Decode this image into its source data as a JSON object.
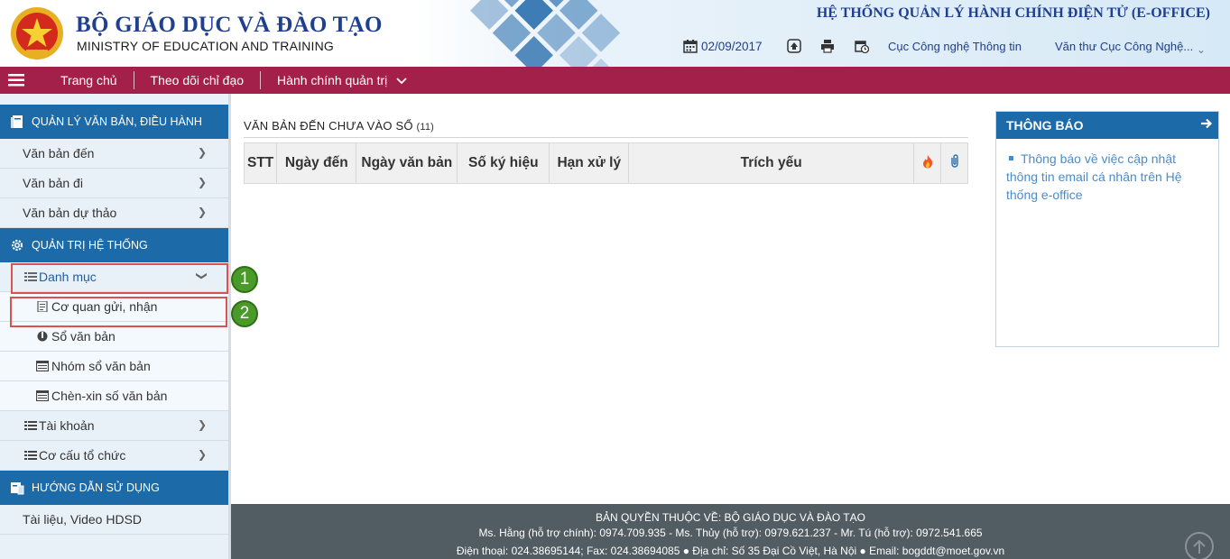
{
  "header": {
    "org_vn": "BỘ GIÁO DỤC VÀ ĐÀO TẠO",
    "org_en": "MINISTRY OF EDUCATION AND TRAINING",
    "system_title": "HỆ THỐNG QUẢN LÝ HÀNH CHÍNH ĐIỆN TỬ (E-OFFICE)",
    "date": "02/09/2017",
    "unit": "Cục Công nghệ Thông tin",
    "user": "Văn thư Cục Công Nghệ..."
  },
  "topnav": {
    "items": [
      {
        "label": "Trang chủ"
      },
      {
        "label": "Theo dõi chỉ đạo"
      },
      {
        "label": "Hành chính quản trị"
      }
    ]
  },
  "sidebar": {
    "section1": {
      "title": "QUẢN LÝ VĂN BẢN, ĐIỀU HÀNH",
      "items": [
        {
          "label": "Văn bản đến"
        },
        {
          "label": "Văn bản đi"
        },
        {
          "label": "Văn bản dự thảo"
        }
      ]
    },
    "section2": {
      "title": "QUẢN TRỊ HỆ THỐNG",
      "danhmuc": "Danh mục",
      "subitems": [
        {
          "label": "Cơ quan gửi, nhận"
        },
        {
          "label": "Sổ văn bản"
        },
        {
          "label": "Nhóm sổ văn bản"
        },
        {
          "label": "Chèn-xin số văn bản"
        }
      ],
      "taikhoan": "Tài khoản",
      "cocau": "Cơ cấu tổ chức"
    },
    "section3": {
      "title": "HƯỚNG DẪN SỬ DỤNG",
      "items": [
        {
          "label": "Tài liệu, Video HDSD"
        }
      ]
    }
  },
  "annotations": {
    "badge1": "1",
    "badge2": "2"
  },
  "main": {
    "title": "VĂN BẢN ĐẾN CHƯA VÀO SỔ",
    "count": "(11)",
    "columns": [
      "STT",
      "Ngày đến",
      "Ngày văn bản",
      "Số ký hiệu",
      "Hạn xử lý",
      "Trích yếu"
    ]
  },
  "notice": {
    "title": "THÔNG BÁO",
    "items": [
      "Thông báo về việc cập nhật thông tin email cá nhân trên Hệ thống e-office"
    ]
  },
  "footer": {
    "line1": "BẢN QUYỀN THUỘC VỀ: BỘ GIÁO DỤC VÀ ĐÀO TẠO",
    "line2": "Ms. Hằng (hỗ trợ chính): 0974.709.935 - Ms. Thủy (hỗ trợ): 0979.621.237 - Mr. Tú (hỗ trợ): 0972.541.665",
    "line3": "Điện thoại: 024.38695144; Fax: 024.38694085 ● Địa chỉ: Số 35 Đại Cồ Việt, Hà Nội ● Email: bogddt@moet.gov.vn"
  },
  "colors": {
    "brand_blue": "#1c6aa8",
    "nav_red": "#a3204a",
    "footer_gray": "#525d63",
    "highlight_red": "#d9534f",
    "badge_green": "#4a9a2a"
  }
}
